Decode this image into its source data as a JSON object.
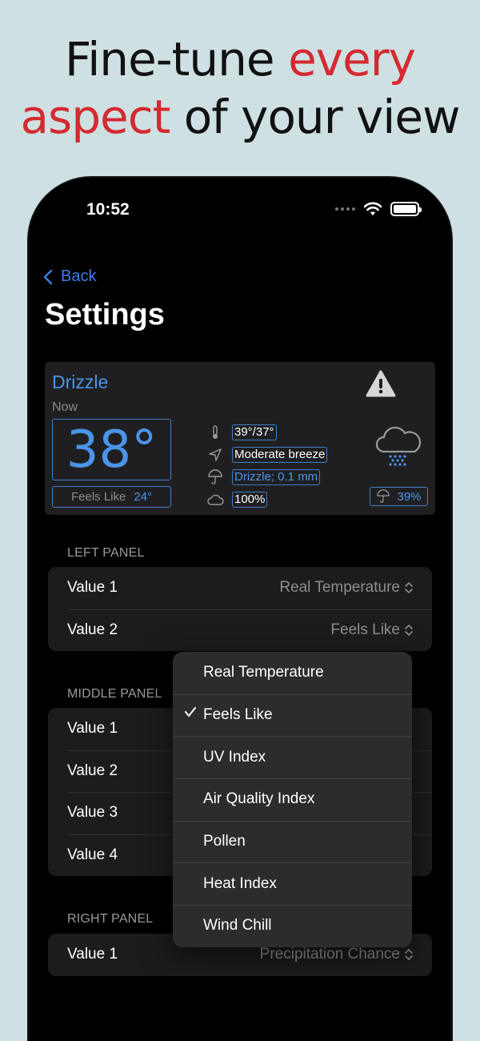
{
  "headline": {
    "line1_plain": "Fine-tune ",
    "line1_accent": "every",
    "line2_accent": "aspect",
    "line2_plain": " of your view"
  },
  "colors": {
    "accent_red": "#d42a30",
    "link_blue": "#3e7fe8",
    "widget_blue": "#4a95ea",
    "background": "#cfe0e3"
  },
  "status_bar": {
    "time": "10:52",
    "icons": [
      "cellular-dots-icon",
      "wifi-icon",
      "battery-icon"
    ]
  },
  "nav": {
    "back_label": "Back",
    "title": "Settings"
  },
  "widget": {
    "condition": "Drizzle",
    "time_label": "Now",
    "temperature": "38°",
    "feels_like_label": "Feels Like",
    "feels_like_value": "24°",
    "details": [
      {
        "icon": "thermometer-icon",
        "value": "39°/37°"
      },
      {
        "icon": "location-arrow-icon",
        "value": "Moderate breeze"
      },
      {
        "icon": "umbrella-icon",
        "value": "Drizzle; 0.1 mm"
      },
      {
        "icon": "cloud-icon",
        "value": "100%"
      }
    ],
    "precip_chance": "39%"
  },
  "left_panel": {
    "label": "LEFT PANEL",
    "rows": [
      {
        "label": "Value 1",
        "value": "Real Temperature"
      },
      {
        "label": "Value 2",
        "value": "Feels Like"
      }
    ]
  },
  "middle_panel": {
    "label": "MIDDLE PANEL",
    "rows": [
      {
        "label": "Value 1"
      },
      {
        "label": "Value 2"
      },
      {
        "label": "Value 3"
      },
      {
        "label": "Value 4"
      }
    ]
  },
  "right_panel": {
    "label": "RIGHT PANEL",
    "rows": [
      {
        "label": "Value 1",
        "value": "Precipitation Chance"
      }
    ]
  },
  "dropdown": {
    "selected": "Feels Like",
    "options": [
      "Real Temperature",
      "Feels Like",
      "UV Index",
      "Air Quality Index",
      "Pollen",
      "Heat Index",
      "Wind Chill"
    ]
  }
}
